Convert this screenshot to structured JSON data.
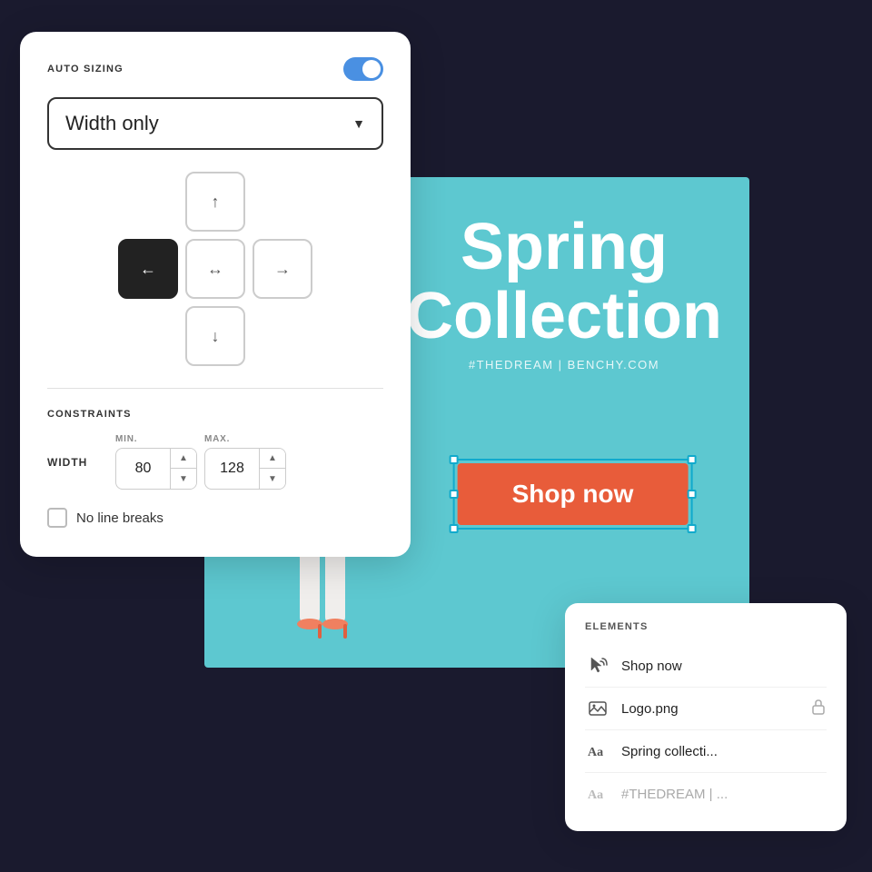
{
  "autoSizingPanel": {
    "label": "AUTO SIZING",
    "toggleActive": true,
    "dropdown": {
      "value": "Width only",
      "arrow": "▼"
    },
    "alignmentButtons": [
      {
        "id": "top",
        "symbol": "↑",
        "active": false
      },
      {
        "id": "left",
        "symbol": "←",
        "active": true
      },
      {
        "id": "horizontal",
        "symbol": "↔",
        "active": false
      },
      {
        "id": "right",
        "symbol": "→",
        "active": false
      },
      {
        "id": "bottom",
        "symbol": "↓",
        "active": false
      }
    ],
    "constraintsLabel": "CONSTRAINTS",
    "widthLabel": "WIDTH",
    "minLabel": "MIN.",
    "maxLabel": "MAX.",
    "minValue": "80",
    "maxValue": "128",
    "checkbox": {
      "label": "No line breaks",
      "checked": false
    }
  },
  "banner": {
    "title": "Spring\nCollection",
    "subtitle": "#THEDREAM | BENCHY.COM",
    "shopNow": "Shop now"
  },
  "elementsPanel": {
    "title": "ELEMENTS",
    "items": [
      {
        "id": "shop-now",
        "iconType": "cursor",
        "name": "Shop now",
        "locked": false
      },
      {
        "id": "logo",
        "iconType": "image",
        "name": "Logo.png",
        "locked": true
      },
      {
        "id": "spring",
        "iconType": "text",
        "name": "Spring collecti...",
        "locked": false,
        "muted": false
      },
      {
        "id": "thedream",
        "iconType": "text",
        "name": "#THEDREAM | ...",
        "locked": false,
        "muted": true
      }
    ]
  }
}
